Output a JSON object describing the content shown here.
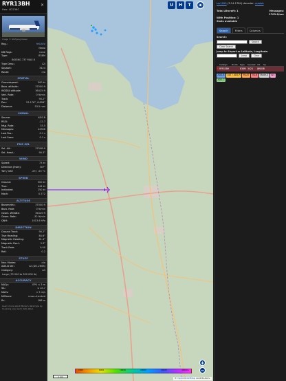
{
  "aircraft": {
    "callsign": "RYR13BH",
    "hex_line": "Hex:  4D236C",
    "photo_credit": "Image © Wolfgang Kaiser",
    "identity": [
      {
        "k": "Reg.:",
        "v": "9H-VUV",
        "link": true
      },
      {
        "k": "",
        "v": "Malta"
      },
      {
        "k": "DB flags:",
        "v": "none"
      },
      {
        "k": "Type:",
        "v": "B38M"
      }
    ],
    "type_full": "BOEING 737 MAX 8",
    "identity2": [
      {
        "k": "Type Desc.:",
        "v": "L2J"
      },
      {
        "k": "Squawk:",
        "v": "3424"
      },
      {
        "k": "Route:",
        "v": "n/a"
      }
    ],
    "sections": [
      {
        "title": "SPATIAL",
        "rows": [
          {
            "k": "Groundspeed:",
            "v": "500 kt"
          },
          {
            "k": "Baro. altitude:",
            "v": "37000 ft"
          },
          {
            "k": "WGS84 altitude:",
            "v": "36425 ft"
          },
          {
            "k": "Vert. Rate:",
            "v": "0 ft/min"
          },
          {
            "k": "Track:",
            "v": "90.2°"
          },
          {
            "k": "Pos.:",
            "v": "53.176°, 6.858°"
          },
          {
            "k": "Distance:",
            "v": "53.5 nmi"
          }
        ]
      },
      {
        "title": "SIGNAL",
        "rows": [
          {
            "k": "Source:",
            "v": "ADS-B"
          },
          {
            "k": "RSSI:",
            "v": "-12.7"
          },
          {
            "k": "Msg. Rate:",
            "v": "33.5"
          },
          {
            "k": "Messages:",
            "v": "44306"
          },
          {
            "k": "Last Pos.:",
            "v": "0.1 s"
          },
          {
            "k": "Last Seen:",
            "v": "0.1 s"
          }
        ]
      },
      {
        "title": "FMS SEL",
        "rows": [
          {
            "k": "Sel. Alt.:",
            "v": "37008 ft"
          },
          {
            "k": "Sel. Head.:",
            "v": "90.3°"
          }
        ]
      },
      {
        "title": "WIND",
        "rows": [
          {
            "k": "Speed:",
            "v": "73 kt"
          },
          {
            "k": "Direction (from):",
            "v": "307°"
          },
          {
            "k": "TAT / OAT:",
            "v": "-29 / -55 °C"
          }
        ]
      },
      {
        "title": "SPEED",
        "rows": [
          {
            "k": "Ground:",
            "v": "500 kt"
          },
          {
            "k": "True:",
            "v": "444 kt"
          },
          {
            "k": "Indicated:",
            "v": "250 kt"
          },
          {
            "k": "Mach:",
            "v": "0.772"
          }
        ]
      },
      {
        "title": "ALTITUDE",
        "rows": [
          {
            "k": "Barometric:",
            "v": "37000 ft"
          },
          {
            "k": "Baro. Rate:",
            "v": "0 ft/min"
          },
          {
            "k": "Geom. WGS84:",
            "v": "36425 ft"
          },
          {
            "k": "Geom. Rate:",
            "v": "-32 ft/min"
          },
          {
            "k": "QNH:",
            "v": "1013.6 hPa"
          }
        ]
      },
      {
        "title": "DIRECTION",
        "rows": [
          {
            "k": "Ground Track:",
            "v": "90.2°"
          },
          {
            "k": "True Heading:",
            "v": "84.6°"
          },
          {
            "k": "Magnetic Heading:",
            "v": "81.4°"
          },
          {
            "k": "Magnetic Decl.:",
            "v": "3.3°"
          },
          {
            "k": "Track Rate:",
            "v": "0.00"
          },
          {
            "k": "Roll:",
            "v": "0.2"
          }
        ]
      },
      {
        "title": "STUFF",
        "rows": [
          {
            "k": "Nav. Modes:",
            "v": "n/a"
          },
          {
            "k": "ADS-B Ver.:",
            "v": "v2 (DO-260B)"
          },
          {
            "k": "Category:",
            "v": "A3"
          }
        ]
      }
    ],
    "category_desc": "Large (75 000 to 300 000 lb)",
    "accuracy_title": "ACCURACY",
    "accuracy": [
      {
        "k": "NACp:",
        "v": "EPU < 3 m"
      },
      {
        "k": "SIL:",
        "v": "≤ 1e-7"
      },
      {
        "k": "NACv:",
        "v": "< 3 m/s"
      },
      {
        "k": "NICbaro:",
        "v": "cross-checked"
      },
      {
        "k": "Rc:",
        "v": "186 m"
      }
    ],
    "footer_note": "Learn more about Mode S data type by hovering over each data label."
  },
  "map": {
    "top_buttons": [
      "U",
      "H",
      "T"
    ],
    "side_buttons": [
      "L",
      "O",
      "K",
      "M",
      "V",
      "P",
      "I",
      "R"
    ],
    "zoom_in": "+",
    "zoom_out": "−",
    "scale_label": "1 km",
    "legend_labels": [
      "2000",
      "6000",
      "10000",
      "20000",
      "30000",
      "40000+"
    ],
    "attribution_prefix": "© ",
    "attribution_link": "OpenStreetMap",
    "attribution_suffix": " contributors.",
    "colors": {
      "track": "#9b2fff",
      "land": "#c7d7bd",
      "water": "#a9c5dd"
    }
  },
  "panel": {
    "version_link": "tar1090",
    "version_text": " (3.14.1784) decoder: ",
    "decoder_link": "readsb",
    "total_label": "Total Aircraft: 1",
    "messages_label": "Messages:",
    "messages_rate": "1703.8/sec",
    "with_position": "With Position: 1",
    "stats_link": "Stats available",
    "tabs": [
      "Search",
      "Filters",
      "Columns"
    ],
    "search_label": "Search:",
    "search_button": "Search",
    "clear_button": "Clear Search",
    "jump_label": "Jump to Airport or Latitude, Longitude:",
    "jump_button": "Jump",
    "clear2_button": "Clear",
    "table_headers": [
      "",
      "Callsign",
      "Route",
      "Type",
      "Squawk",
      "Alt. (ft)",
      "Sp"
    ],
    "table_rows": [
      {
        "callsign": "RYR13BH",
        "route": "",
        "type": "B38M",
        "squawk": "3424",
        "alt": "37000",
        "sp": "5"
      }
    ],
    "badges": [
      "ADS-B",
      "UAT / ADS-R",
      "MLAT",
      "TIS-B",
      "Mode-S",
      "AIS",
      "ADS-C"
    ]
  }
}
